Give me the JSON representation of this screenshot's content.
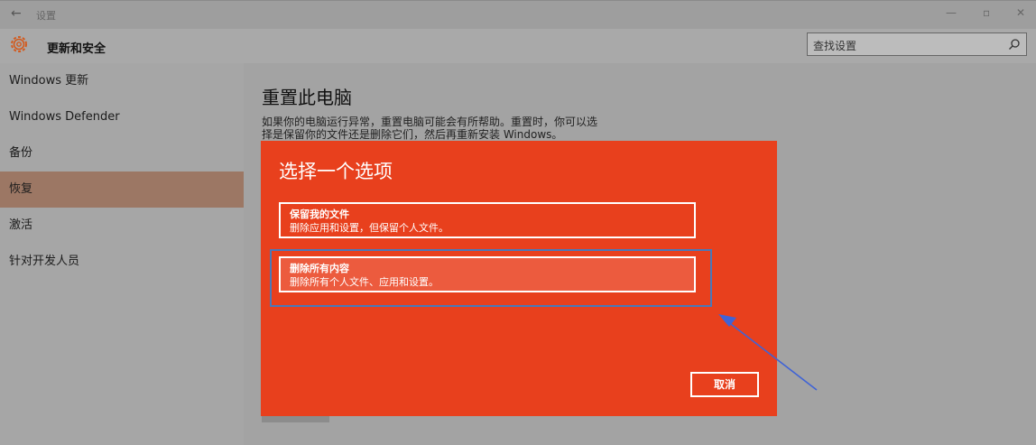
{
  "window": {
    "back_glyph": "←",
    "title": "设置",
    "minimize_glyph": "—",
    "restore_glyph": "▫",
    "close_glyph": "✕"
  },
  "header": {
    "icon": "gear-icon",
    "title": "更新和安全",
    "search_placeholder": "查找设置",
    "search_icon": "search-icon"
  },
  "sidebar": {
    "items": [
      {
        "label": "Windows 更新"
      },
      {
        "label": "Windows Defender"
      },
      {
        "label": "备份"
      },
      {
        "label": "恢复"
      },
      {
        "label": "激活"
      },
      {
        "label": "针对开发人员"
      }
    ],
    "active_index": 3
  },
  "main": {
    "title": "重置此电脑",
    "description": "如果你的电脑运行异常，重置电脑可能会有所帮助。重置时，你可以选择是保留你的文件还是删除它们，然后再重新安装 Windows。"
  },
  "dialog": {
    "title": "选择一个选项",
    "options": [
      {
        "title": "保留我的文件",
        "description": "删除应用和设置，但保留个人文件。"
      },
      {
        "title": "删除所有内容",
        "description": "删除所有个人文件、应用和设置。"
      }
    ],
    "cancel_label": "取消"
  },
  "colors": {
    "dialog_background": "#e8401d",
    "active_sidebar": "#9c7764",
    "focus_ring": "#4a78b8",
    "annotation_arrow": "#3f63d6"
  }
}
